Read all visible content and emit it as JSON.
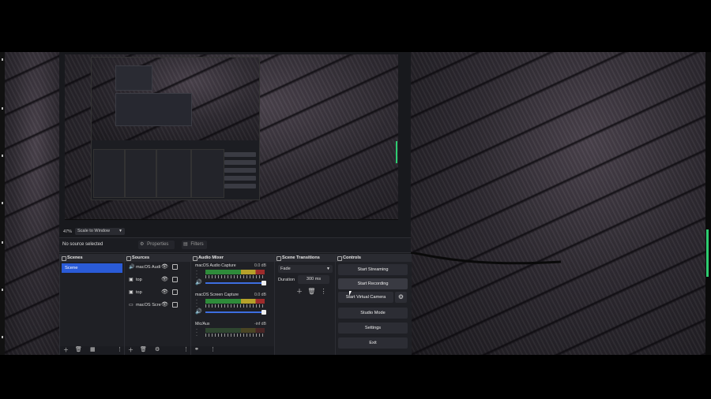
{
  "obs": {
    "zoom": "47%",
    "scale_mode": "Scale to Window",
    "no_source": "No source selected",
    "properties_label": "Properties",
    "filters_label": "Filters"
  },
  "scenes": {
    "title": "Scenes",
    "items": [
      "Scene"
    ]
  },
  "sources": {
    "title": "Sources",
    "items": [
      {
        "name": "macOS Audi",
        "icon": "speaker-icon"
      },
      {
        "name": "top",
        "icon": "image-icon"
      },
      {
        "name": "top",
        "icon": "image-icon"
      },
      {
        "name": "macOS Scre",
        "icon": "monitor-icon"
      }
    ]
  },
  "audio_mixer": {
    "title": "Audio Mixer",
    "channels": [
      {
        "name": "macOS Audio Capture",
        "db": "0.0 dB",
        "volume": 1.0
      },
      {
        "name": "macOS Screen Capture",
        "db": "0.0 dB",
        "volume": 1.0
      },
      {
        "name": "Mic/Aux",
        "db": "-inf dB",
        "volume": 0.0
      }
    ]
  },
  "transitions": {
    "title": "Scene Transitions",
    "type": "Fade",
    "duration_label": "Duration",
    "duration_value": "300 ms"
  },
  "controls": {
    "title": "Controls",
    "start_streaming": "Start Streaming",
    "start_recording": "Start Recording",
    "start_virtual_camera": "Start Virtual Camera",
    "studio_mode": "Studio Mode",
    "settings": "Settings",
    "exit": "Exit"
  },
  "colors": {
    "accent": "#2a5bd7",
    "meter_green": "#2e8b3a",
    "meter_yellow": "#b6a12a",
    "meter_red": "#9e2b2b",
    "panel": "#1f2025"
  }
}
